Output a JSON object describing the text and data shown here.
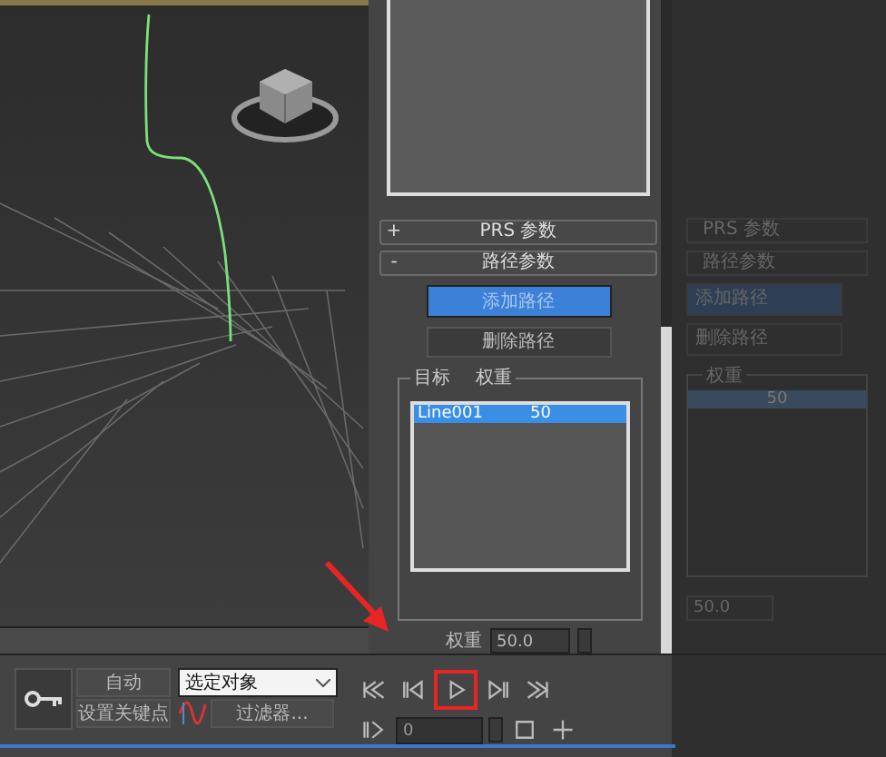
{
  "viewport": {
    "kind": "perspective"
  },
  "command_panel": {
    "rollouts": [
      {
        "toggle": "+",
        "label": "PRS 参数"
      },
      {
        "toggle": "-",
        "label": "路径参数"
      }
    ],
    "buttons": [
      {
        "label": "添加路径",
        "selected": true
      },
      {
        "label": "删除路径",
        "selected": false
      }
    ],
    "list": {
      "columns": [
        "目标",
        "权重"
      ],
      "rows": [
        {
          "target": "Line001",
          "weight": "50",
          "selected": true
        }
      ]
    },
    "weight": {
      "label": "权重",
      "value": "50.0"
    }
  },
  "background_panel": {
    "rollouts": [
      "PRS 参数",
      "路径参数"
    ],
    "buttons": [
      "添加路径",
      "删除路径"
    ],
    "group_label": "权重",
    "row_value": "50",
    "weight_value": "50.0"
  },
  "animation_controls": {
    "auto_key": "自动",
    "set_key": "设置关键点",
    "key_filter": "选定对象",
    "filters": "过滤器...",
    "frame": "0",
    "play_highlighted": true
  }
}
